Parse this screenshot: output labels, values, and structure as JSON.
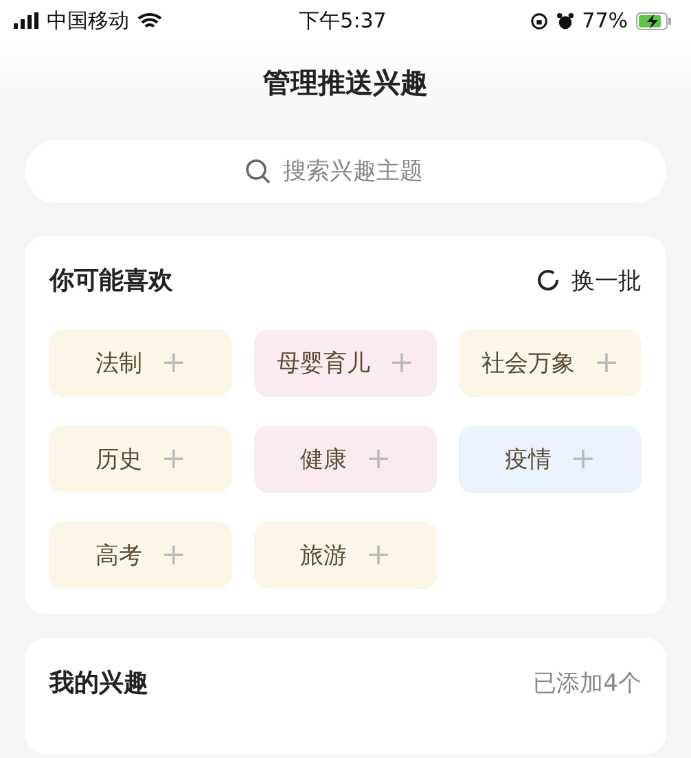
{
  "status_bar": {
    "carrier": "中国移动",
    "time": "下午5:37",
    "battery": "77%"
  },
  "title": "管理推送兴趣",
  "search": {
    "placeholder": "搜索兴趣主题"
  },
  "suggestions": {
    "heading": "你可能喜欢",
    "refresh": "换一批",
    "add_mark": "+",
    "tags": [
      {
        "label": "法制",
        "color": "#fbf6e7"
      },
      {
        "label": "母婴育儿",
        "color": "#faebf1"
      },
      {
        "label": "社会万象",
        "color": "#fbf6e7"
      },
      {
        "label": "历史",
        "color": "#fbf6e7"
      },
      {
        "label": "健康",
        "color": "#faebf1"
      },
      {
        "label": "疫情",
        "color": "#eaf2fc"
      },
      {
        "label": "高考",
        "color": "#fbf6e7"
      },
      {
        "label": "旅游",
        "color": "#fbf6e7"
      }
    ]
  },
  "my_interests": {
    "heading": "我的兴趣",
    "count": "已添加4个"
  }
}
